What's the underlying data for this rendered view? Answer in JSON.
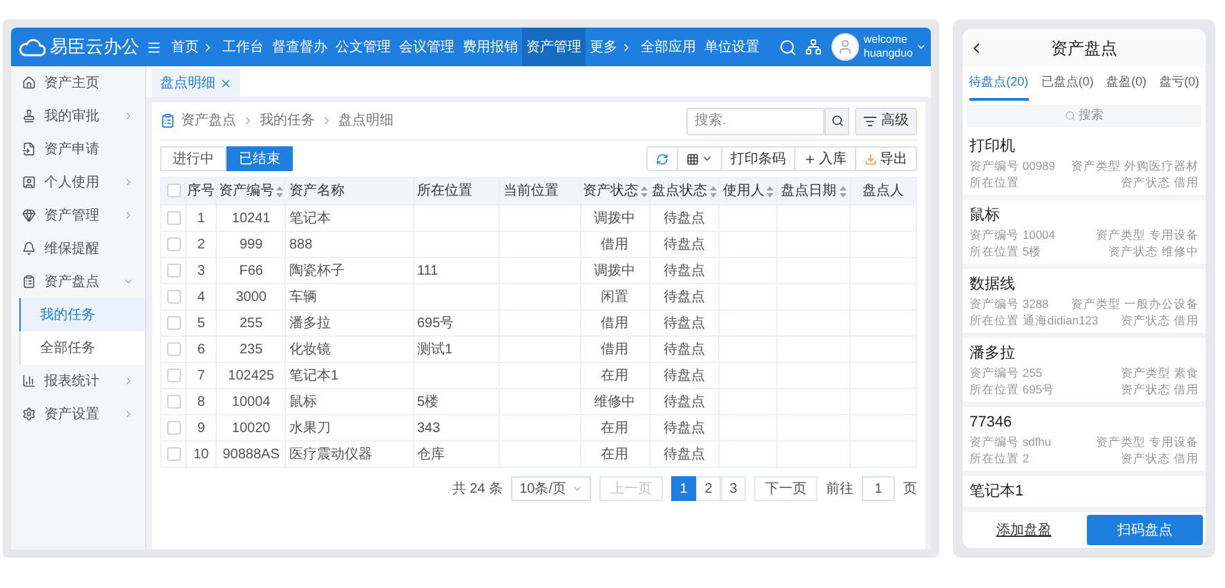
{
  "app": {
    "logo": "易臣云办公",
    "user_greeting": "welcome",
    "user_name": "huangduo"
  },
  "nav": [
    {
      "label": "首页",
      "arrow": true,
      "selected": false
    },
    {
      "label": "工作台",
      "arrow": false,
      "selected": false
    },
    {
      "label": "督查督办",
      "arrow": false,
      "selected": false
    },
    {
      "label": "公文管理",
      "arrow": false,
      "selected": false
    },
    {
      "label": "会议管理",
      "arrow": false,
      "selected": false
    },
    {
      "label": "费用报销",
      "arrow": false,
      "selected": false
    },
    {
      "label": "资产管理",
      "arrow": false,
      "selected": true
    },
    {
      "label": "更多",
      "arrow": true,
      "selected": false
    },
    {
      "label": "全部应用",
      "arrow": false,
      "selected": false
    },
    {
      "label": "单位设置",
      "arrow": false,
      "selected": false
    }
  ],
  "sidebar": {
    "items": [
      {
        "label": "资产主页",
        "kind": "link"
      },
      {
        "label": "我的审批",
        "kind": "group",
        "expanded": false
      },
      {
        "label": "资产申请",
        "kind": "link"
      },
      {
        "label": "个人使用",
        "kind": "group",
        "expanded": false
      },
      {
        "label": "资产管理",
        "kind": "group",
        "expanded": false
      },
      {
        "label": "维保提醒",
        "kind": "link"
      },
      {
        "label": "资产盘点",
        "kind": "group",
        "expanded": true,
        "children": [
          {
            "label": "我的任务",
            "selected": true
          },
          {
            "label": "全部任务",
            "selected": false
          }
        ]
      },
      {
        "label": "报表统计",
        "kind": "group",
        "expanded": false
      },
      {
        "label": "资产设置",
        "kind": "group",
        "expanded": false
      }
    ]
  },
  "page_tabs": [
    {
      "label": "盘点明细",
      "selected": true,
      "closable": true
    }
  ],
  "breadcrumb": [
    "资产盘点",
    "我的任务",
    "盘点明细"
  ],
  "search": {
    "placeholder": "搜索.",
    "advanced": "高级"
  },
  "status_toggle": [
    {
      "label": "进行中",
      "selected": false
    },
    {
      "label": "已结束",
      "selected": true
    }
  ],
  "toolbar": {
    "print": "打印条码",
    "add": "入库",
    "export": "导出"
  },
  "table": {
    "all_checked": false,
    "columns": [
      {
        "label": "序号",
        "sortable": false
      },
      {
        "label": "资产编号",
        "sortable": true
      },
      {
        "label": "资产名称",
        "sortable": false
      },
      {
        "label": "所在位置",
        "sortable": false
      },
      {
        "label": "当前位置",
        "sortable": false
      },
      {
        "label": "资产状态",
        "sortable": true
      },
      {
        "label": "盘点状态",
        "sortable": true
      },
      {
        "label": "使用人",
        "sortable": true
      },
      {
        "label": "盘点日期",
        "sortable": true
      },
      {
        "label": "盘点人",
        "sortable": false
      }
    ],
    "rows": [
      {
        "checked": false,
        "no": "1",
        "code": "10241",
        "name": "笔记本",
        "status": "调拨中",
        "check_status": "待盘点"
      },
      {
        "checked": false,
        "no": "2",
        "code": "999",
        "name": "888",
        "status": "借用",
        "check_status": "待盘点"
      },
      {
        "checked": false,
        "no": "3",
        "code": "F66",
        "name": "陶瓷杯子",
        "location": "111",
        "status": "调拨中",
        "check_status": "待盘点"
      },
      {
        "checked": false,
        "no": "4",
        "code": "3000",
        "name": "车辆",
        "status": "闲置",
        "check_status": "待盘点"
      },
      {
        "checked": false,
        "no": "5",
        "code": "255",
        "name": "潘多拉",
        "location": "695号",
        "status": "借用",
        "check_status": "待盘点"
      },
      {
        "checked": false,
        "no": "6",
        "code": "235",
        "name": "化妆镜",
        "location": "测试1",
        "status": "借用",
        "check_status": "待盘点"
      },
      {
        "checked": false,
        "no": "7",
        "code": "102425",
        "name": "笔记本1",
        "status": "在用",
        "check_status": "待盘点"
      },
      {
        "checked": false,
        "no": "8",
        "code": "10004",
        "name": "鼠标",
        "location": "5楼",
        "status": "维修中",
        "check_status": "待盘点"
      },
      {
        "checked": false,
        "no": "9",
        "code": "10020",
        "name": "水果刀",
        "location": "343",
        "status": "在用",
        "check_status": "待盘点"
      },
      {
        "checked": false,
        "no": "10",
        "code": "90888AS",
        "name": "医疗震动仪器",
        "location": "仓库",
        "status": "在用",
        "check_status": "待盘点"
      }
    ]
  },
  "pagination": {
    "total": "共 24 条",
    "page_size": "10条/页",
    "prev": "上一页",
    "prev_disabled": true,
    "pages": [
      {
        "label": "1",
        "selected": true
      },
      {
        "label": "2",
        "selected": false
      },
      {
        "label": "3",
        "selected": false
      }
    ],
    "next": "下一页",
    "goto_label": "前往",
    "goto_value": "1",
    "goto_suffix": "页"
  },
  "mobile": {
    "title": "资产盘点",
    "tabs": [
      {
        "label": "待盘点(20)",
        "selected": true
      },
      {
        "label": "已盘点(0)",
        "selected": false
      },
      {
        "label": "盘盈(0)",
        "selected": false
      },
      {
        "label": "盘亏(0)",
        "selected": false
      }
    ],
    "search_placeholder": "搜索",
    "items": [
      {
        "title": "打印机",
        "fields": [
          {
            "label": "资产编号",
            "value": "00989"
          },
          {
            "label": "资产类型",
            "value": "外购医疗器材"
          },
          {
            "label": "所在位置"
          },
          {
            "label": "资产状态",
            "value": "借用"
          }
        ]
      },
      {
        "title": "鼠标",
        "fields": [
          {
            "label": "资产编号",
            "value": "10004"
          },
          {
            "label": "资产类型",
            "value": "专用设备"
          },
          {
            "label": "所在位置",
            "value": "5楼"
          },
          {
            "label": "资产状态",
            "value": "维修中"
          }
        ]
      },
      {
        "title": "数据线",
        "fields": [
          {
            "label": "资产编号",
            "value": "3288"
          },
          {
            "label": "资产类型",
            "value": "一般办公设备"
          },
          {
            "label": "所在位置",
            "value": "通海didian123"
          },
          {
            "label": "资产状态",
            "value": "借用"
          }
        ]
      },
      {
        "title": "潘多拉",
        "fields": [
          {
            "label": "资产编号",
            "value": "255"
          },
          {
            "label": "资产类型",
            "value": "素食"
          },
          {
            "label": "所在位置",
            "value": "695号"
          },
          {
            "label": "资产状态",
            "value": "借用"
          }
        ]
      },
      {
        "title": "77346",
        "fields": [
          {
            "label": "资产编号",
            "value": "sdfhu"
          },
          {
            "label": "资产类型",
            "value": "专用设备"
          },
          {
            "label": "所在位置",
            "value": "2"
          },
          {
            "label": "资产状态",
            "value": "借用"
          }
        ]
      },
      {
        "title": "笔记本1"
      }
    ],
    "buttons": [
      {
        "label": "添加盘盈",
        "kind": "secondary"
      },
      {
        "label": "扫码盘点",
        "kind": "primary"
      }
    ]
  }
}
